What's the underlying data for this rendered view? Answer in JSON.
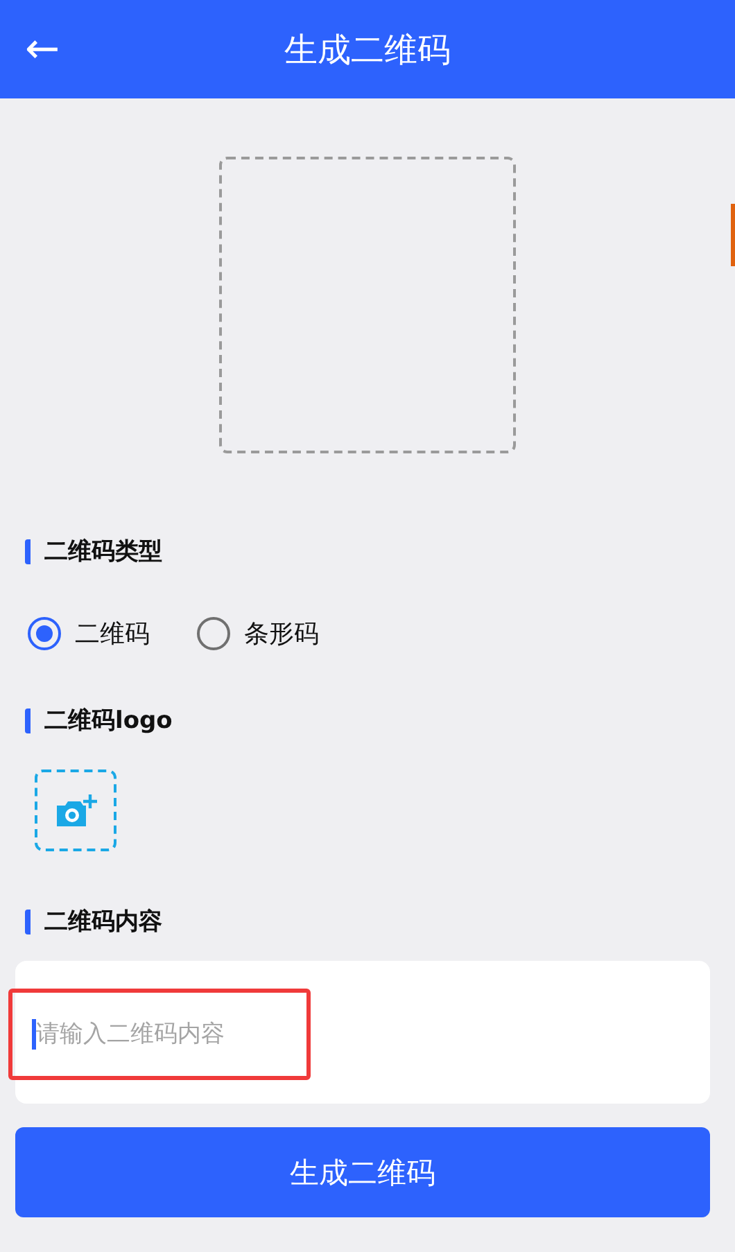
{
  "header": {
    "back_icon": "←",
    "title": "生成二维码"
  },
  "type_section": {
    "title": "二维码类型",
    "options": [
      {
        "label": "二维码",
        "selected": true
      },
      {
        "label": "条形码",
        "selected": false
      }
    ]
  },
  "logo_section": {
    "title": "二维码logo"
  },
  "content_section": {
    "title": "二维码内容",
    "placeholder": "请输入二维码内容",
    "focused": true,
    "highlighted": true
  },
  "generate_button": {
    "label": "生成二维码"
  }
}
